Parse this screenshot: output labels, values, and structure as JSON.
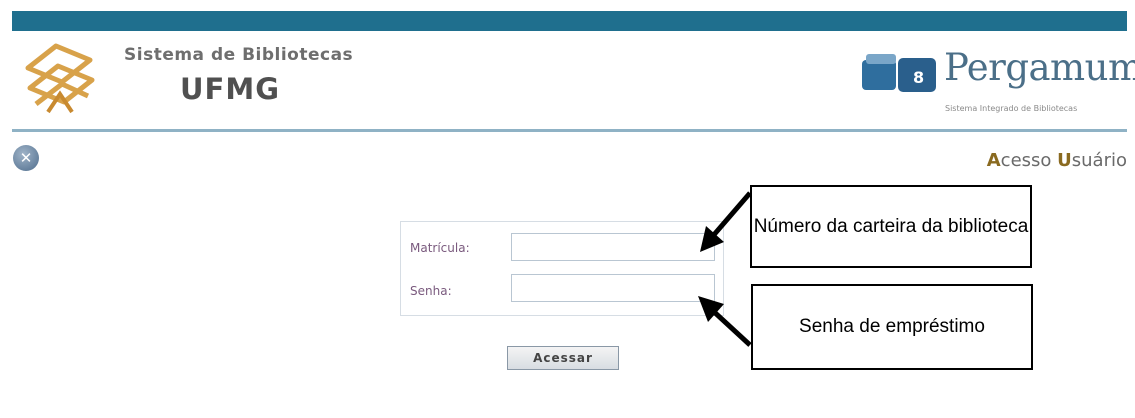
{
  "header": {
    "org_line1": "Sistema de Bibliotecas",
    "org_line2": "UFMG",
    "brand_name": "Pergamum",
    "brand_subtitle": "Sistema Integrado de Bibliotecas",
    "colors": {
      "topbar": "#1f6f8e",
      "divider": "#8fb2c5",
      "brand": "#4b6f88"
    }
  },
  "toolbar": {
    "close_icon": "close-icon"
  },
  "page": {
    "title_first": "A",
    "title_mid": "cesso ",
    "title_cap2": "U",
    "title_rest": "suário"
  },
  "form": {
    "matricula_label": "Matrícula:",
    "matricula_value": "",
    "senha_label": "Senha:",
    "senha_value": "",
    "submit_label": "Acessar"
  },
  "annotations": {
    "matricula_note": "Número da carteira da biblioteca",
    "senha_note": "Senha de empréstimo"
  }
}
